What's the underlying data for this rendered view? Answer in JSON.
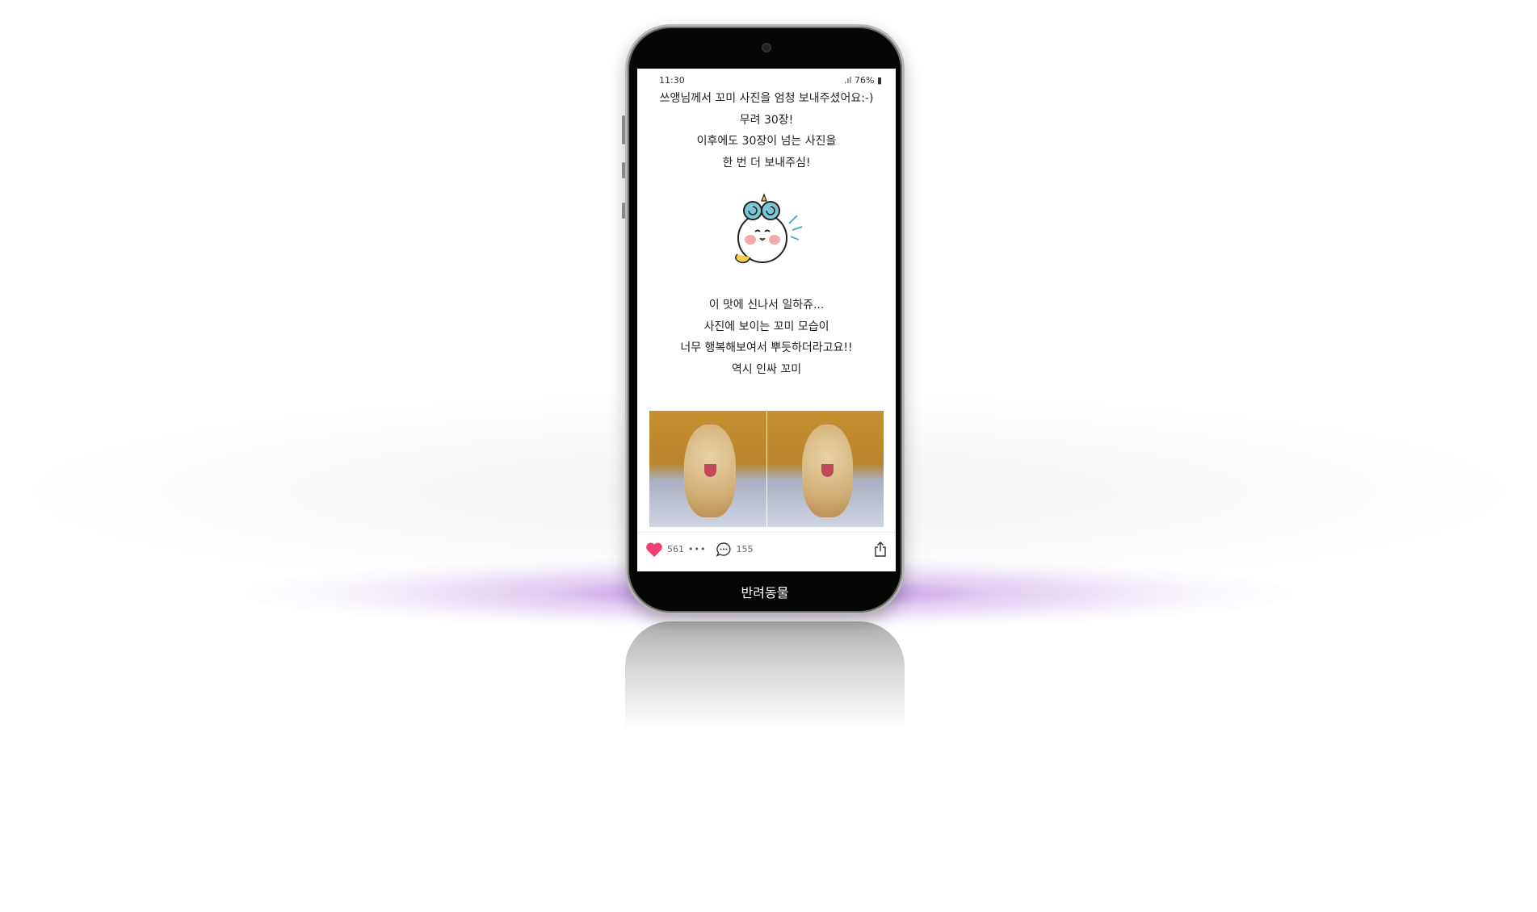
{
  "status_bar": {
    "time": "11:30",
    "battery": "76%"
  },
  "post": {
    "intro_lines": [
      "쓰앵님께서 꼬미 사진을 엄청 보내주셨어요:-)",
      "무려 30장!",
      "이후에도 30장이 넘는 사진을",
      "한 번 더 보내주심!"
    ],
    "body_lines": [
      "이 맛에 신나서 일하쥬...",
      "사진에 보이는 꼬미 모습이",
      "너무 행복해보여서 뿌듯하더라고요!!",
      "역시 인싸 꼬미"
    ]
  },
  "actions": {
    "likes": "561",
    "comments": "155"
  },
  "category_label": "반려동물",
  "colors": {
    "heart": "#f0406e",
    "glow": "#9a4fd6"
  }
}
